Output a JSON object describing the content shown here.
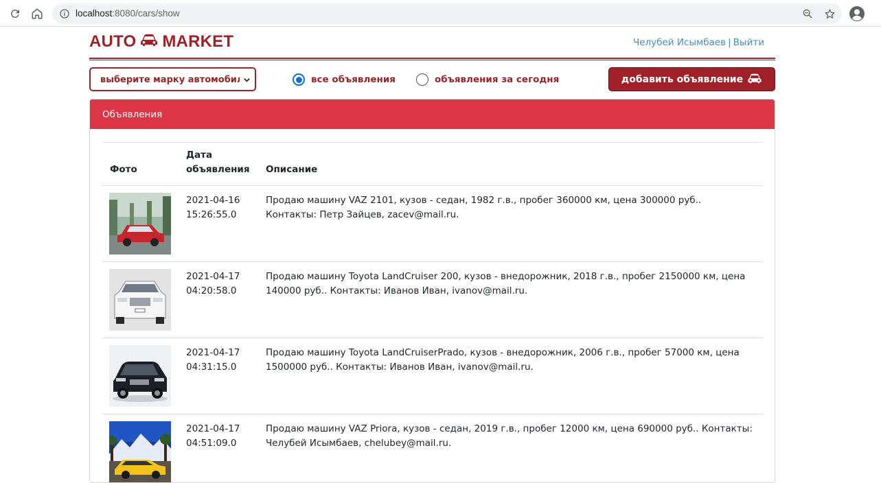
{
  "browser": {
    "url_host": "localhost",
    "url_rest": ":8080/cars/show"
  },
  "header": {
    "logo_left": "AUTO",
    "logo_right": "MARKET",
    "user_name": "Челубей Исымбаев",
    "separator": "|",
    "logout": "Выйти"
  },
  "filters": {
    "brand_select": "выберите марку автомобиля",
    "radio_all": "все объявления",
    "radio_today": "объявления за сегодня",
    "add_button": "добавить объявление"
  },
  "card": {
    "title": "Объявления",
    "columns": [
      "Фото",
      "Дата объявления",
      "Описание"
    ],
    "rows": [
      {
        "date": "2021-04-16 15:26:55.0",
        "description": "Продаю машину VAZ 2101, кузов - седан, 1982 г.в., пробег 360000 км, цена 300000 руб.. Контакты: Петр Зайцев, zacev@mail.ru.",
        "photo": "red-sedan-photo"
      },
      {
        "date": "2021-04-17 04:20:58.0",
        "description": "Продаю машину Toyota LandCruiser 200, кузов - внедорожник, 2018 г.в., пробег 2150000 км, цена 140000 руб.. Контакты: Иванов Иван, ivanov@mail.ru.",
        "photo": "white-suv-photo"
      },
      {
        "date": "2021-04-17 04:31:15.0",
        "description": "Продаю машину Toyota LandCruiserPrado, кузов - внедорожник, 2006 г.в., пробег 57000 км, цена 1500000 руб.. Контакты: Иванов Иван, ivanov@mail.ru.",
        "photo": "black-suv-photo"
      },
      {
        "date": "2021-04-17 04:51:09.0",
        "description": "Продаю машину VAZ Priora, кузов - седан, 2019 г.в., пробег 12000 км, цена 690000 руб.. Контакты: Челубей Исымбаев, chelubey@mail.ru.",
        "photo": "yellow-car-photo"
      }
    ]
  },
  "colors": {
    "brand": "#a02228",
    "header_red": "#dc3545",
    "link_blue": "#3e8ed0",
    "radio_blue": "#0b6fe0"
  }
}
